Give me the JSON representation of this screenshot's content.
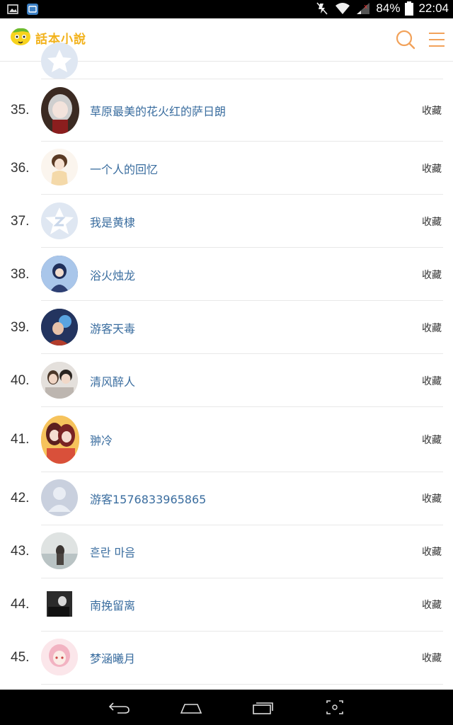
{
  "status_bar": {
    "battery": "84%",
    "time": "22:04"
  },
  "header": {
    "app_name": "話本小說"
  },
  "rows": [
    {
      "rank": "35.",
      "name": "草原最美的花火红的萨日朗",
      "action": "收藏"
    },
    {
      "rank": "36.",
      "name": "一个人的回忆",
      "action": "收藏"
    },
    {
      "rank": "37.",
      "name": "我是黄棣",
      "action": "收藏"
    },
    {
      "rank": "38.",
      "name": "浴火烛龙",
      "action": "收藏"
    },
    {
      "rank": "39.",
      "name": "游客天毒",
      "action": "收藏"
    },
    {
      "rank": "40.",
      "name": "清风醉人",
      "action": "收藏"
    },
    {
      "rank": "41.",
      "name": "翀冷",
      "action": "收藏"
    },
    {
      "rank": "42.",
      "name": "游客1576833965865",
      "action": "收藏"
    },
    {
      "rank": "43.",
      "name": "흔란 마음",
      "action": "收藏"
    },
    {
      "rank": "44.",
      "name": "南挽留离",
      "action": "收藏"
    },
    {
      "rank": "45.",
      "name": "梦涵曦月",
      "action": "收藏"
    }
  ],
  "colors": {
    "accent": "#f2a25a",
    "logo_yellow": "#f2b21b",
    "username": "#3a6d9f"
  }
}
